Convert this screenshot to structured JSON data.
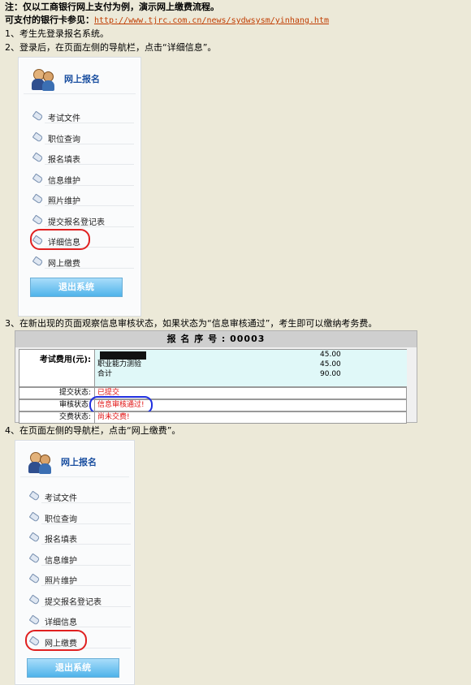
{
  "intro": {
    "note": "注：仅以工商银行网上支付为例，演示网上缴费流程。",
    "cards_prefix": "可支付的银行卡参见：",
    "cards_link": "http://www.tjrc.com.cn/news/sydwsysm/yinhang.htm"
  },
  "steps": {
    "s1": "1、考生先登录报名系统。",
    "s2": "2、登录后，在页面左侧的导航栏，点击“详细信息”。",
    "s3": "3、在新出现的页面观察信息审核状态，如果状态为“信息审核通过”，考生即可以缴纳考务费。",
    "s4": "4、在页面左侧的导航栏，点击“网上缴费”。"
  },
  "nav": {
    "title": "网上报名",
    "items": [
      "考试文件",
      "职位查询",
      "报名填表",
      "信息维护",
      "照片维护",
      "提交报名登记表",
      "详细信息",
      "网上缴费"
    ],
    "exit": "退出系统"
  },
  "status_screen": {
    "reg_no": "报 名 序 号 : 00003",
    "fee_label": "考试费用(元):",
    "fees": [
      {
        "name": "",
        "amount": "45.00"
      },
      {
        "name": "职业能力测验",
        "amount": "45.00"
      },
      {
        "name": "合计",
        "amount": "90.00"
      }
    ],
    "rows": [
      {
        "label": "提交状态:",
        "value": "已提交"
      },
      {
        "label": "审核状态:",
        "value": "信息审核通过!"
      },
      {
        "label": "交费状态:",
        "value": "尚未交费!"
      }
    ]
  },
  "colors": {
    "link": "#c03c00",
    "status_red": "#e01010",
    "highlight_red": "#e02020",
    "highlight_blue": "#2030e0",
    "nav_title": "#1a4fa0"
  }
}
